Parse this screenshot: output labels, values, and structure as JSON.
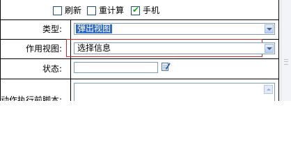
{
  "options": {
    "refresh_label": "刷新",
    "refresh_checked": false,
    "recalc_label": "重计算",
    "recalc_checked": false,
    "mobile_label": "手机",
    "mobile_checked": true
  },
  "rows": {
    "type": {
      "label": "类型:",
      "value": "弹出视图"
    },
    "view": {
      "label": "作用视图:",
      "value": "选择信息"
    },
    "status": {
      "label": "状态:",
      "value": ""
    },
    "script": {
      "label": "动作执行前脚本:"
    }
  },
  "icons": {
    "edit": "edit-icon",
    "dropdown": "chevron-down-icon",
    "scroll_up": "scroll-up-icon"
  },
  "colors": {
    "selection": "#316ac5",
    "field_border": "#7f9db9",
    "highlight_frame": "#c8282c",
    "checkmark": "#21a121"
  }
}
